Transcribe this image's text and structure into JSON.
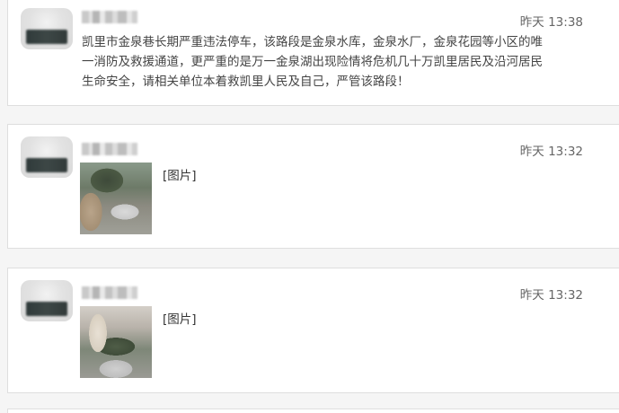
{
  "posts": [
    {
      "timestamp": "昨天 13:38",
      "text": "凯里市金泉巷长期严重违法停车，该路段是金泉水库，金泉水厂，金泉花园等小区的唯一消防及救援通道，更严重的是万一金泉湖出现险情将危机几十万凯里居民及沿河居民生命安全，请相关单位本着救凯里人民及自己，严管该路段！"
    },
    {
      "timestamp": "昨天 13:32",
      "image_label": "[图片]"
    },
    {
      "timestamp": "昨天 13:32",
      "image_label": "[图片]"
    }
  ]
}
